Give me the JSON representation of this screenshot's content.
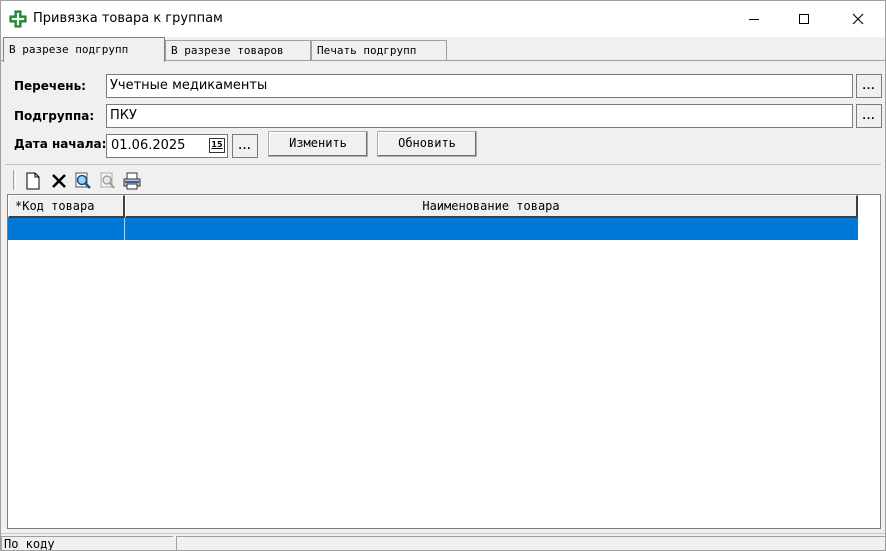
{
  "window": {
    "title": "Привязка товара к группам",
    "icon": "green-cross-icon"
  },
  "tabs": [
    {
      "label": "В разрезе подгрупп",
      "active": true
    },
    {
      "label": "В разрезе товаров",
      "active": false
    },
    {
      "label": "Печать подгрупп",
      "active": false
    }
  ],
  "form": {
    "list_label": "Перечень:",
    "list_value": "Учетные медикаменты",
    "subgroup_label": "Подгруппа:",
    "subgroup_value": "ПКУ",
    "date_label": "Дата начала:",
    "date_value": "01.06.2025",
    "calendar_text": "15",
    "dots": "...",
    "change_button": "Изменить",
    "refresh_button": "Обновить"
  },
  "toolbar": {
    "icons": [
      "new-document-icon",
      "delete-icon",
      "find-icon",
      "find-next-icon",
      "print-icon"
    ]
  },
  "grid": {
    "columns": [
      "*Код товара",
      "Наименование товара"
    ],
    "rows": [
      [
        "",
        ""
      ]
    ]
  },
  "statusbar": {
    "mode": "По коду",
    "second": ""
  },
  "colors": {
    "selection": "#0078d7",
    "app_icon": "#2e9e3e"
  }
}
